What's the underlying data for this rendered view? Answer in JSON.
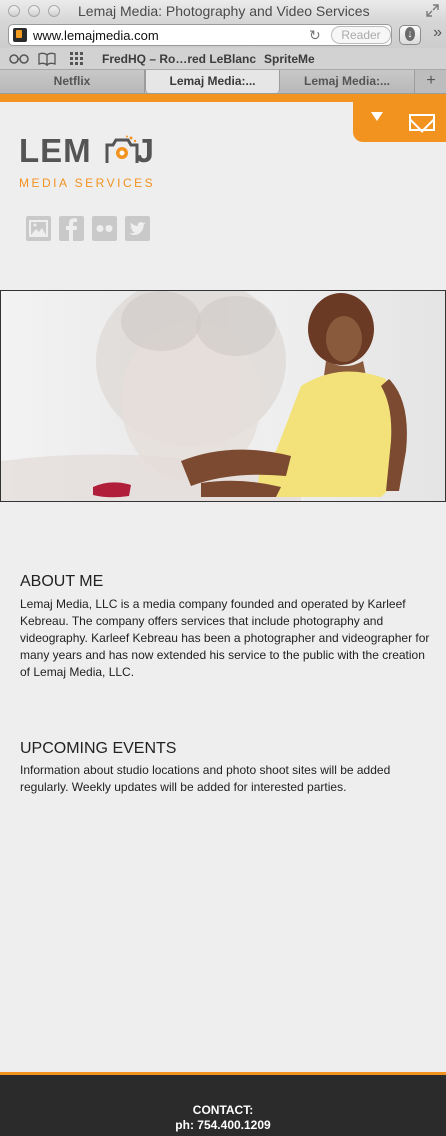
{
  "browser": {
    "window_title": "Lemaj Media: Photography and Video Services",
    "url": "www.lemajmedia.com",
    "reader_label": "Reader",
    "bookmarks": [
      "FredHQ – Ro…red LeBlanc",
      "SpriteMe"
    ],
    "tabs": [
      {
        "label": "Netflix",
        "active": false
      },
      {
        "label": "Lemaj Media:...",
        "active": true
      },
      {
        "label": "Lemaj Media:...",
        "active": false
      }
    ],
    "new_tab_label": "+"
  },
  "site": {
    "logo_word_left": "LEM",
    "logo_word_right": "J",
    "logo_subtitle": "MEDIA SERVICES",
    "accent_color": "#f2921f",
    "social_icons": [
      "image-icon",
      "facebook-icon",
      "flickr-icon",
      "twitter-icon"
    ]
  },
  "about": {
    "title": "ABOUT ME",
    "body": "Lemaj Media, LLC is a media company founded and operated by Karleef Kebreau.  The company offers services that include photography and videography.  Karleef Kebreau has been a photographer and videographer for many years and has now extended his service to the public with the creation of Lemaj Media, LLC."
  },
  "events": {
    "title": "UPCOMING EVENTS",
    "body": "Information about studio locations and photo shoot sites will be added regularly. Weekly updates will be added for interested parties."
  },
  "footer": {
    "contact_label": "CONTACT:",
    "phone": "ph: 754.400.1209"
  }
}
